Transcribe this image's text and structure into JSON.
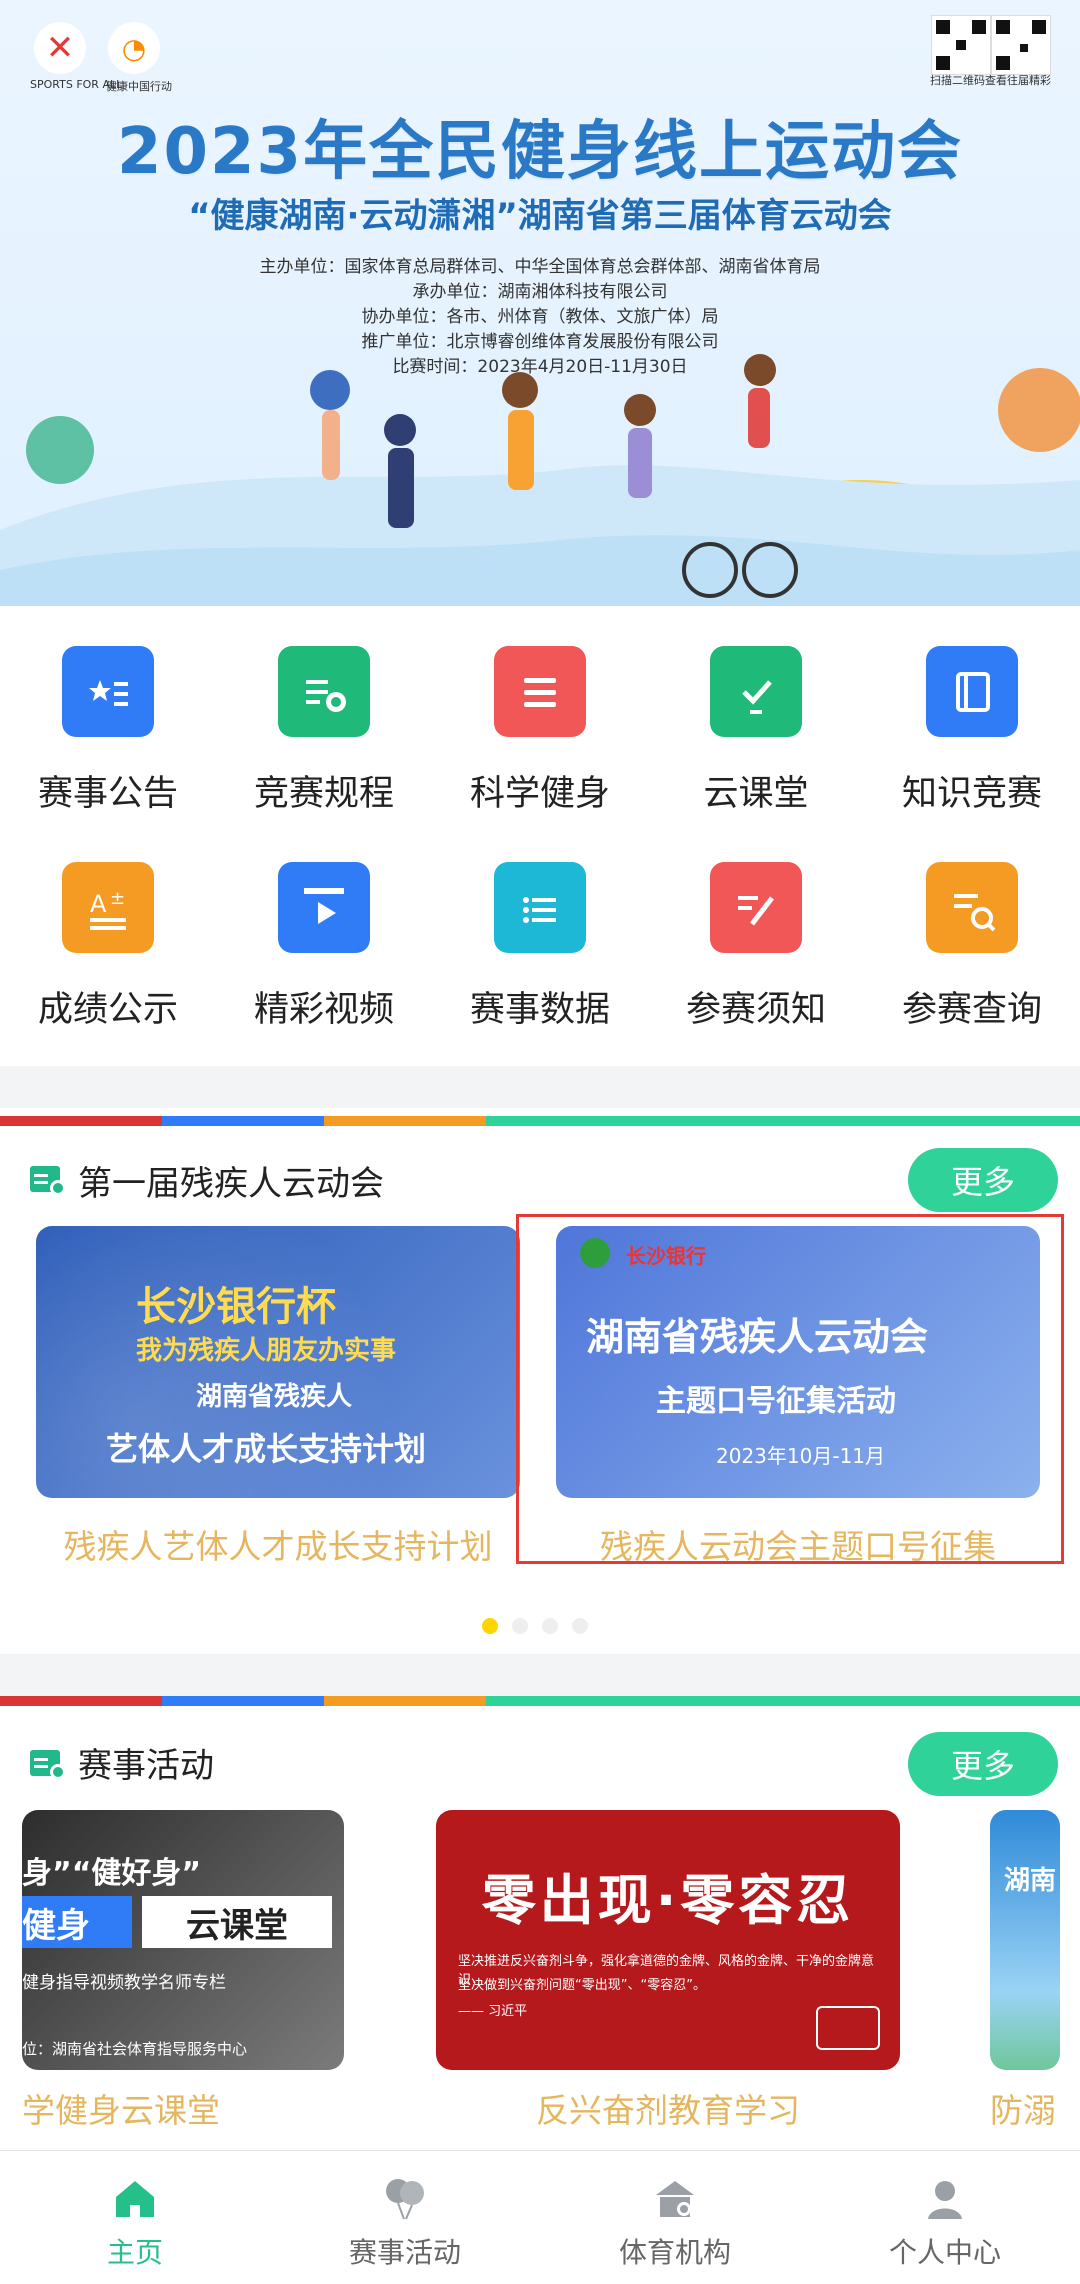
{
  "banner": {
    "logo1_caption": "SPORTS FOR ALL",
    "logo2_caption": "健康中国行动",
    "title": "2023年全民健身线上运动会",
    "subtitle": "“健康湖南·云动潇湘”湖南省第三届体育云动会",
    "org_lines": [
      "主办单位：国家体育总局群体司、中华全国体育总会群体部、湖南省体育局",
      "承办单位：湖南湘体科技有限公司",
      "协办单位：各市、州体育（教体、文旅广体）局",
      "推广单位：北京博睿创维体育发展股份有限公司",
      "比赛时间：2023年4月20日-11月30日"
    ],
    "qr_caption": "扫描二维码查看往届精彩"
  },
  "grid": {
    "items": [
      {
        "label": "赛事公告",
        "icon": "book-star-icon",
        "color": "#2f7cf6"
      },
      {
        "label": "竞赛规程",
        "icon": "folder-document-icon",
        "color": "#1fb97a"
      },
      {
        "label": "科学健身",
        "icon": "list-document-icon",
        "color": "#f25757"
      },
      {
        "label": "云课堂",
        "icon": "checked-screen-icon",
        "color": "#1fb97a"
      },
      {
        "label": "知识竞赛",
        "icon": "book-icon",
        "color": "#2f7cf6"
      },
      {
        "label": "成绩公示",
        "icon": "grade-icon",
        "color": "#f59b23"
      },
      {
        "label": "精彩视频",
        "icon": "video-clapper-icon",
        "color": "#2f7cf6"
      },
      {
        "label": "赛事数据",
        "icon": "folder-list-icon",
        "color": "#1db8d6"
      },
      {
        "label": "参赛须知",
        "icon": "pen-document-icon",
        "color": "#f25757"
      },
      {
        "label": "参赛查询",
        "icon": "search-document-icon",
        "color": "#f59b23"
      }
    ]
  },
  "section1": {
    "title": "第一届残疾人云动会",
    "more": "更多",
    "cards": [
      {
        "caption": "残疾人艺体人才成长支持计划",
        "line1": "长沙银行杯",
        "line2": "我为残疾人朋友办实事",
        "line3": "湖南省残疾人",
        "line4": "艺体人才成长支持计划"
      },
      {
        "caption": "残疾人云动会主题口号征集",
        "brand": "长沙银行",
        "line1": "湖南省残疾人云动会",
        "line2": "主题口号征集活动",
        "line3": "2023年10月-11月"
      }
    ]
  },
  "section2": {
    "title": "赛事活动",
    "more": "更多",
    "cards": [
      {
        "caption": "学健身云课堂",
        "line1": "身”“健好身”",
        "line2": "健身",
        "line3": "云课堂",
        "line4": "健身指导视频教学名师专栏",
        "line5": "位：湖南省社会体育指导服务中心"
      },
      {
        "caption": "反兴奋剂教育学习",
        "line1": "零出现·零容忍",
        "line2": "坚决推进反兴奋剂斗争，强化拿道德的金牌、风格的金牌、干净的金牌意识，",
        "line3": "坚决做到兴奋剂问题“零出现”、“零容忍”。",
        "line4": "—— 习近平"
      },
      {
        "caption": "防溺",
        "line1": "湖南"
      }
    ]
  },
  "tabbar": {
    "items": [
      {
        "label": "主页",
        "icon": "home-icon",
        "active": true
      },
      {
        "label": "赛事活动",
        "icon": "balloons-icon",
        "active": false
      },
      {
        "label": "体育机构",
        "icon": "building-icon",
        "active": false
      },
      {
        "label": "个人中心",
        "icon": "user-icon",
        "active": false
      }
    ]
  },
  "colors": {
    "accent": "#2fd39a",
    "caption": "#e6b65e",
    "highlight_box": "#e53935"
  }
}
